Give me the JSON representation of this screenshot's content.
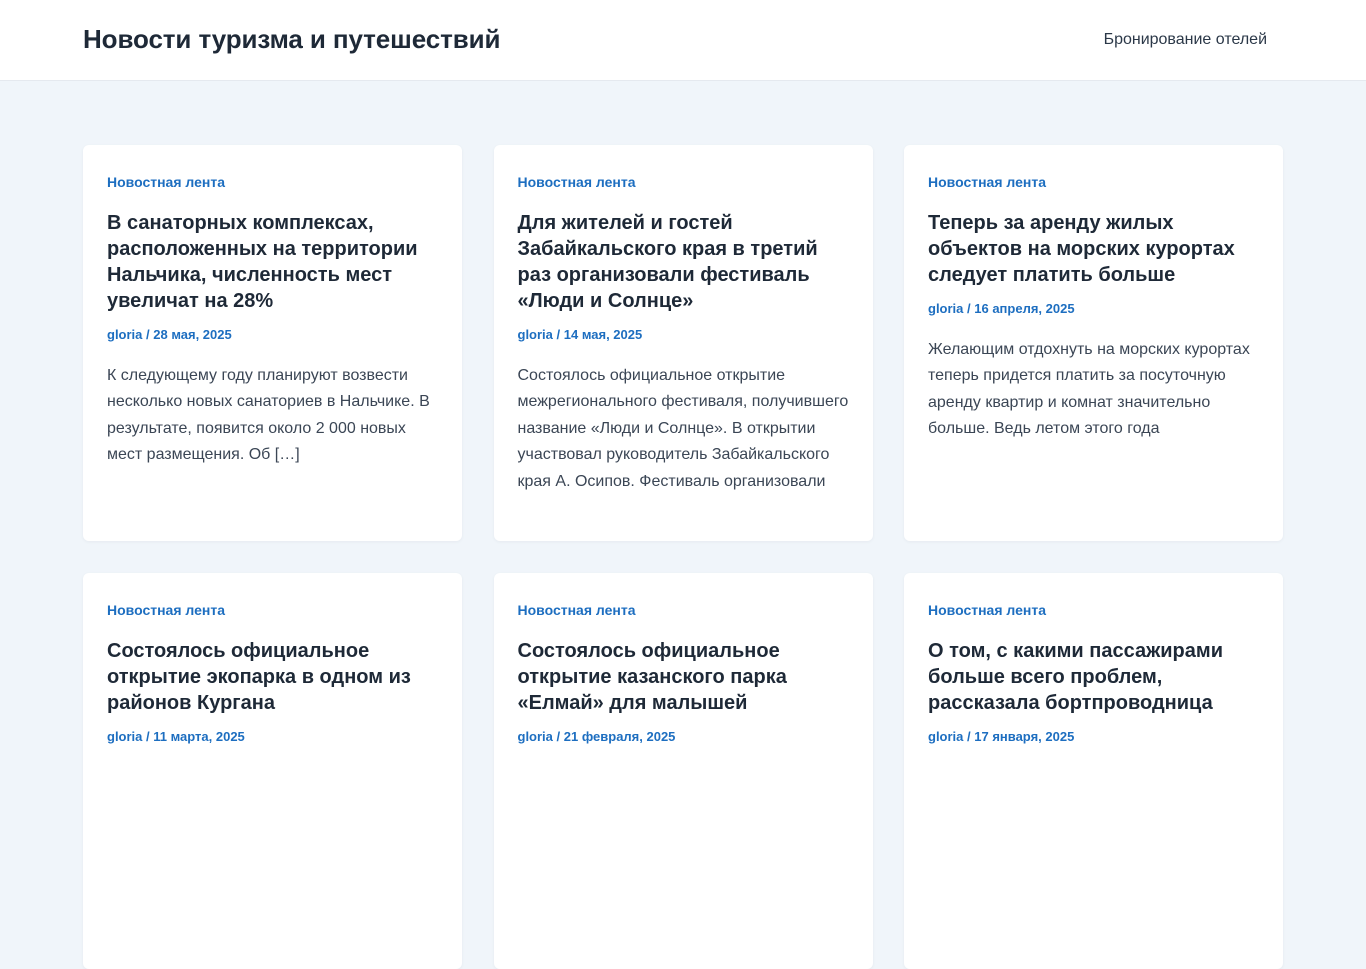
{
  "header": {
    "site_title": "Новости туризма и путешествий",
    "nav_link": "Бронирование отелей"
  },
  "posts": [
    {
      "category": "Новостная лента",
      "title": "В санаторных комплексах, расположенных на территории Нальчика, численность мест увеличат на 28%",
      "author": "gloria",
      "separator": " / ",
      "date": "28 мая, 2025",
      "excerpt": "К следующему году планируют возвести несколько новых санаториев в Нальчике. В результате, появится около 2 000 новых мест размещения. Об […]"
    },
    {
      "category": "Новостная лента",
      "title": "Для жителей и гостей Забайкальского края в третий раз организовали фестиваль «Люди и Солнце»",
      "author": "gloria",
      "separator": " / ",
      "date": "14 мая, 2025",
      "excerpt": "Состоялось официальное открытие межрегионального фестиваля, получившего название «Люди и Солнце». В открытии участвовал руководитель Забайкальского края А. Осипов. Фестиваль организовали"
    },
    {
      "category": "Новостная лента",
      "title": "Теперь за аренду жилых объектов на морских курортах следует платить больше",
      "author": "gloria",
      "separator": " / ",
      "date": "16 апреля, 2025",
      "excerpt": "Желающим отдохнуть на морских курортах теперь придется платить за посуточную аренду квартир и комнат значительно больше. Ведь летом этого года"
    },
    {
      "category": "Новостная лента",
      "title": "Состоялось официальное открытие экопарка в одном из районов Кургана",
      "author": "gloria",
      "separator": " / ",
      "date": "11 марта, 2025",
      "excerpt": ""
    },
    {
      "category": "Новостная лента",
      "title": "Состоялось официальное открытие казанского парка «Елмай» для малышей",
      "author": "gloria",
      "separator": " / ",
      "date": "21 февраля, 2025",
      "excerpt": ""
    },
    {
      "category": "Новостная лента",
      "title": "О том, с какими пассажирами больше всего проблем, рассказала бортпроводница",
      "author": "gloria",
      "separator": " / ",
      "date": "17 января, 2025",
      "excerpt": ""
    }
  ]
}
